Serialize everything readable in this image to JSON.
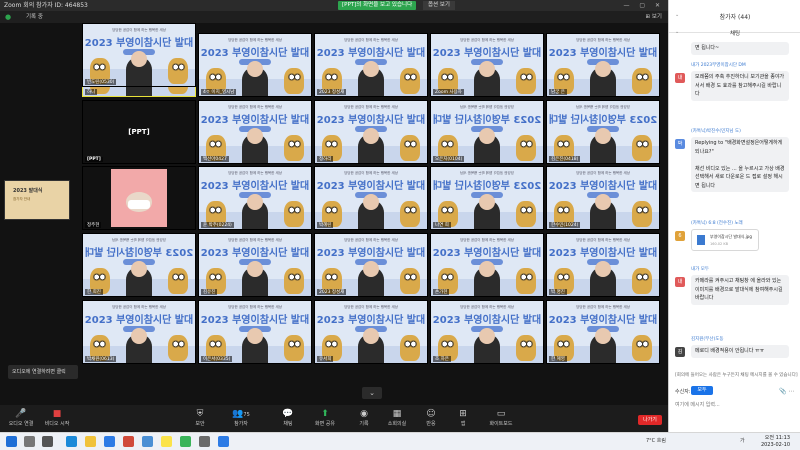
{
  "titlebar": {
    "app_title": "Zoom 회의 참가자 ID: 464853",
    "share_notice": "[PPT]의 화면을 보고 있습니다",
    "view_options": "옵션 보기",
    "window_controls": "— ▢ ✕"
  },
  "infobar": {
    "label": "기록 중",
    "view": "⊞ 보기"
  },
  "tiles": [
    {
      "kind": "banner",
      "name": "하니",
      "title": "2023 부영이참시단 발대식",
      "top": "당당한 공감이 함께 하는 행복한 세상"
    },
    {
      "kind": "banner",
      "name": "4ㅇ 이지_영시남",
      "title": "2023 부영이참시단 발대식",
      "top": "당당한 공감이 함께 하는 행복한 세상"
    },
    {
      "kind": "banner",
      "name": "2023 정성재",
      "title": "2023 부영이참시단 발대식",
      "top": "당당한 공감이 함께 하는 행복한 세상"
    },
    {
      "kind": "banner",
      "name": "Zoom 사용자",
      "title": "2023 부영이참시단 발대식",
      "top": "당당한 공감이 함께 하는 행복한 세상"
    },
    {
      "kind": "banner",
      "name": "남궁 은",
      "title": "2023 부영이참시단 발대식",
      "top": "당당한 공감이 함께 하는 행복한 세상"
    },
    {
      "kind": "text",
      "name": "[PPT]",
      "label": "[PPT]"
    },
    {
      "kind": "banner",
      "name": "백선아0427",
      "title": "2023 부영이참시단 발대식",
      "top": "당당한 공감이 함께 하는 행복한 세상"
    },
    {
      "kind": "banner",
      "name": "정하리",
      "title": "2023 부영이참시단 발대식",
      "top": "당당한 공감이 함께 하는 행복한 세상"
    },
    {
      "kind": "banner",
      "name": "오은지(0104)",
      "title": "2023 부영이참시단 발대식",
      "top": "당당한 공감이 함께 하는 행복한 세상",
      "mirror": true
    },
    {
      "kind": "banner",
      "name": "김은진(0418)",
      "title": "2023 부영이참시단 발대식",
      "top": "당당한 공감이 함께 하는 행복한 세상",
      "mirror": true
    },
    {
      "kind": "pink",
      "name": "정주현"
    },
    {
      "kind": "banner",
      "name": "윤 박주(0224)",
      "title": "2023 부영이참시단 발대식",
      "top": "당당한 공감이 함께 하는 행복한 세상"
    },
    {
      "kind": "banner",
      "name": "박혜린",
      "title": "2023 부영이참시단 발대식",
      "top": "당당한 공감이 함께 하는 행복한 세상"
    },
    {
      "kind": "banner",
      "name": "나연 희",
      "title": "2023 부영이참시단 발대식",
      "top": "당당한 공감이 함께 하는 행복한 세상",
      "mirror": true
    },
    {
      "kind": "banner",
      "name": "한수민(1024)",
      "title": "2023 부영이참시단 발대식",
      "top": "당당한 공감이 함께 하는 행복한 세상"
    },
    {
      "kind": "banner",
      "name": "한 희진",
      "title": "2023 부영이참시단 발대식",
      "top": "당당한 공감이 함께 하는 행복한 세상",
      "mirror": true
    },
    {
      "kind": "banner",
      "name": "김유진",
      "title": "2023 부영이참시단 발대식",
      "top": "당당한 공감이 함께 하는 행복한 세상"
    },
    {
      "kind": "banner",
      "name": "2023 정성재",
      "title": "2023 부영이참시단 발대식",
      "top": "당당한 공감이 함께 하는 행복한 세상"
    },
    {
      "kind": "banner",
      "name": "손가현",
      "title": "2023 부영이참시단 발대식",
      "top": "당당한 공감이 함께 하는 행복한 세상"
    },
    {
      "kind": "banner",
      "name": "박 명진",
      "title": "2023 부영이참시단 발대식",
      "top": "당당한 공감이 함께 하는 행복한 세상"
    },
    {
      "kind": "banner",
      "name": "박채원(0613)",
      "title": "2023 부영이참시단 발대식",
      "top": "당당한 공감이 함께 하는 행복한 세상"
    },
    {
      "kind": "banner",
      "name": "이은서(0335)",
      "title": "2023 부영이참시단 발대식",
      "top": "당당한 공감이 함께 하는 행복한 세상"
    },
    {
      "kind": "banner",
      "name": "유서희",
      "title": "2023 부영이참시단 발대식",
      "top": "당당한 공감이 함께 하는 행복한 세상"
    },
    {
      "kind": "banner",
      "name": "조 하은",
      "title": "2023 부영이참시단 발대식",
      "top": "당당한 공감이 함께 하는 행복한 세상"
    },
    {
      "kind": "banner",
      "name": "한 혜영",
      "title": "2023 부영이참시단 발대식",
      "top": "당당한 공감이 함께 하는 행복한 세상"
    },
    {
      "kind": "banner",
      "name": "빈도린(0530)",
      "title": "2023 부영이참시단 발대식",
      "top": "당당한 공감이 함께 하는 행복한 세상"
    }
  ],
  "side_thumb": {
    "title": "2023 발대식",
    "subtitle": "참가자 안내"
  },
  "audio_tip": "오디오에 연결하려면 클릭",
  "toolbar": {
    "unmute": "오디오 연결",
    "video": "비디오 시작",
    "security": "보안",
    "participants": "참가자",
    "participants_count": "75",
    "chat": "채팅",
    "share": "화면 공유",
    "record": "기록",
    "breakout": "소회의실",
    "reactions": "반응",
    "apps": "앱",
    "whiteboard": "화이트보드",
    "leave": "나가기"
  },
  "panel": {
    "participants_header": "참가자 (44)",
    "chat_header": "채팅",
    "notice": "[회의에 들어오는 사람은 누구든지 채팅 메시지를 볼 수 있습니다]",
    "to_label": "수신자:",
    "to_value": "모두",
    "input_placeholder": "여기에 메시지 입력...",
    "messages": [
      {
        "from": "",
        "text": "면 됩니다~",
        "av": "",
        "color": "#ffffff"
      },
      {
        "from": "내가 2023부영이참시단 DM",
        "text": "모레쯤의 주축 추진하더니 보기관을 종야가서서 배경 도 효과를 참고해주시길 바랍니다",
        "av": "내",
        "color": "#e05a5a"
      },
      {
        "from": "(카톡닉)박진수(민지님 도)",
        "text": "Replying to \"배경화면설정은어떻게하게되나요?\"\n\n채선 비디오 있는 ... 을 누르시고 가상 배경 선택해서 새로 다운로운 드 접로 설정 해시면 됩니다",
        "av": "박",
        "color": "#5a8be0"
      },
      {
        "from": "(카톡닉) 6:8 (전수진) 노래",
        "file": "부영이참시단 발대식.jpg",
        "size": "160.02 KB",
        "av": "6",
        "color": "#e0a23a"
      },
      {
        "from": "내가 모두",
        "text": "카메라를 켜주시고 채팅창 에 올라와 있는 이미지를 배경으로 발대식에 참여해주시길 바랍니다",
        "av": "내",
        "color": "#e05a5a"
      },
      {
        "from": "김지원(부산)도동",
        "text": "메로디 배경적용이 안됩니다 ㅠㅠ",
        "av": "김",
        "color": "#444444"
      }
    ]
  },
  "taskbar": {
    "weather": "7°C 흐림",
    "lang": "가",
    "time": "오전 11:13",
    "date": "2023-02-10"
  }
}
